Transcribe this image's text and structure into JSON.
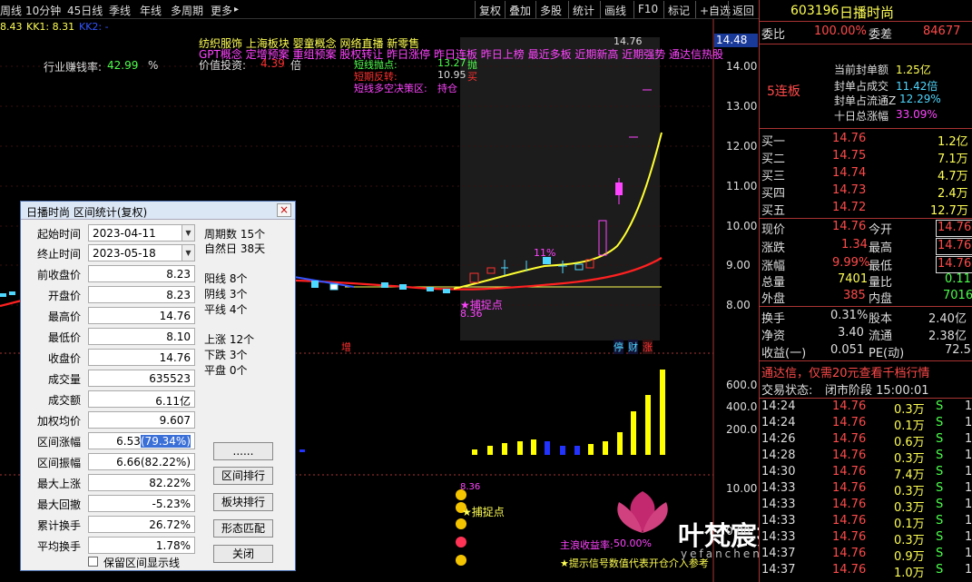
{
  "toolbar": {
    "left_tabs": [
      "周线",
      "10分钟",
      "45日线",
      "季线",
      "年线",
      "多周期",
      "更多"
    ],
    "more_arrow": "▸",
    "right_buttons": [
      "复权",
      "叠加",
      "多股",
      "统计",
      "画线",
      "F10",
      "标记",
      "+自选",
      "返回"
    ]
  },
  "indicator_line": {
    "a": "8.43",
    "kk1": "KK1: 8.31",
    "kk2": "KK2: -"
  },
  "chart_labels": {
    "industry_label": "行业赚钱率:",
    "industry_value": "42.99",
    "industry_unit": "%",
    "concepts": "纺织服饰  上海板块  婴童概念 网络直播 新零售",
    "tags": "GPT概念  定增预案 重组预案 股权转让 昨日涨停 昨日连板 昨日上榜 最近多板 近期新高 近期强势 通达信热股",
    "value_invest_label": "价值投资:",
    "value_invest_value": "4.39",
    "value_invest_unit": "倍",
    "short_point_label": "短线抛点:",
    "short_point_value": "13.27",
    "short_point_sig": "抛",
    "short_rev_label": "短期反转:",
    "short_rev_value": "10.95",
    "short_rev_sig": "买",
    "short_dec_label": "短线多空决策区:",
    "short_dec_value": "持仓",
    "top_price": "14.76",
    "pct_label": "11%",
    "capture_point": "★捕捉点",
    "capture_price": "8.36",
    "zeng": "增",
    "badges": [
      "停",
      "财",
      "涨"
    ],
    "sub_capture_price": "8.36",
    "sub_capture": "★捕捉点",
    "main_profit": "主浪收益率:",
    "main_profit_value": "50.00%",
    "hint": "★提示信号数值代表开仓介入参考",
    "watermark": "叶梵宸指标公式网",
    "watermark_url": "yefanchen.com"
  },
  "price_axis": {
    "current": "14.48",
    "ticks": [
      "14.00",
      "13.00",
      "12.00",
      "11.00",
      "10.00",
      "9.00",
      "8.00"
    ],
    "vol_ticks": [
      "600.0",
      "400.0",
      "200.0"
    ],
    "sub_ticks": [
      "10.00",
      "0.00"
    ]
  },
  "dialog": {
    "title": "日播时尚 区间统计(复权)",
    "close": "×",
    "start_label": "起始时间",
    "start_value": "2023-04-11",
    "end_label": "终止时间",
    "end_value": "2023-05-18",
    "period_label": "周期数 15个",
    "natural_label": "自然日 38天",
    "fields": [
      {
        "label": "前收盘价",
        "value": "8.23"
      },
      {
        "label": "开盘价",
        "value": "8.23"
      },
      {
        "label": "最高价",
        "value": "14.76"
      },
      {
        "label": "最低价",
        "value": "8.10"
      },
      {
        "label": "收盘价",
        "value": "14.76"
      },
      {
        "label": "成交量",
        "value": "635523"
      },
      {
        "label": "成交额",
        "value": "6.11亿"
      },
      {
        "label": "加权均价",
        "value": "9.607"
      },
      {
        "label": "区间涨幅",
        "value": "6.53",
        "value_hl": "(79.34%)"
      },
      {
        "label": "区间振幅",
        "value": "6.66(82.22%)"
      },
      {
        "label": "最大上涨",
        "value": "82.22%"
      },
      {
        "label": "最大回撤",
        "value": "-5.23%"
      },
      {
        "label": "累计换手",
        "value": "26.72%"
      },
      {
        "label": "平均换手",
        "value": "1.78%"
      }
    ],
    "right_stats": [
      "阳线 8个",
      "阴线 3个",
      "平线 4个",
      "上涨 12个",
      "下跌 3个",
      "平盘 0个"
    ],
    "buttons": [
      "......",
      "区间排行",
      "板块排行",
      "形态匹配",
      "关闭"
    ],
    "checkbox_label": "保留区间显示线"
  },
  "quote": {
    "code": "603196",
    "name": "日播时尚",
    "wb_label": "委比",
    "wb_value": "100.00%",
    "wc_label": "委差",
    "wc_value": "84677",
    "board": "5连板",
    "info": [
      {
        "label": "当前封单额",
        "value": "1.25亿"
      },
      {
        "label": "封单占成交",
        "value": "11.42倍"
      },
      {
        "label": "封单占流通Z",
        "value": "12.29%"
      },
      {
        "label": "十日总涨幅",
        "value": "33.09%"
      }
    ],
    "bids": [
      {
        "label": "买一",
        "price": "14.76",
        "vol": "1.2亿"
      },
      {
        "label": "买二",
        "price": "14.75",
        "vol": "7.1万"
      },
      {
        "label": "买三",
        "price": "14.74",
        "vol": "4.7万"
      },
      {
        "label": "买四",
        "price": "14.73",
        "vol": "2.4万"
      },
      {
        "label": "买五",
        "price": "14.72",
        "vol": "12.7万"
      }
    ],
    "stats": [
      {
        "l1": "现价",
        "v1": "14.76",
        "l2": "今开",
        "v2": "14.76"
      },
      {
        "l1": "涨跌",
        "v1": "1.34",
        "l2": "最高",
        "v2": "14.76"
      },
      {
        "l1": "涨幅",
        "v1": "9.99%",
        "l2": "最低",
        "v2": "14.76"
      },
      {
        "l1": "总量",
        "v1": "7401",
        "l2": "量比",
        "v2": "0.11"
      },
      {
        "l1": "外盘",
        "v1": "385",
        "l2": "内盘",
        "v2": "7016"
      }
    ],
    "stats2": [
      {
        "l1": "换手",
        "v1": "0.31%",
        "l2": "股本",
        "v2": "2.40亿"
      },
      {
        "l1": "净资",
        "v1": "3.40",
        "l2": "流通",
        "v2": "2.38亿"
      },
      {
        "l1": "收益(一)",
        "v1": "0.051",
        "l2": "PE(动)",
        "v2": "72.5"
      }
    ],
    "ad": "通达信，仅需20元查看千档行情",
    "status_label": "交易状态:",
    "status_value": "闭市阶段 15:00:01",
    "ticks": [
      {
        "t": "14:24",
        "p": "14.76",
        "v": "0.3万",
        "s": "S",
        "n": "1"
      },
      {
        "t": "14:24",
        "p": "14.76",
        "v": "0.1万",
        "s": "S",
        "n": "1"
      },
      {
        "t": "14:26",
        "p": "14.76",
        "v": "0.6万",
        "s": "S",
        "n": "1"
      },
      {
        "t": "14:28",
        "p": "14.76",
        "v": "0.3万",
        "s": "S",
        "n": "1"
      },
      {
        "t": "14:30",
        "p": "14.76",
        "v": "7.4万",
        "s": "S",
        "n": "1"
      },
      {
        "t": "14:33",
        "p": "14.76",
        "v": "0.3万",
        "s": "S",
        "n": "1"
      },
      {
        "t": "14:33",
        "p": "14.76",
        "v": "0.3万",
        "s": "S",
        "n": "1"
      },
      {
        "t": "14:33",
        "p": "14.76",
        "v": "0.1万",
        "s": "S",
        "n": "1"
      },
      {
        "t": "14:33",
        "p": "14.76",
        "v": "0.3万",
        "s": "S",
        "n": "1"
      },
      {
        "t": "14:37",
        "p": "14.76",
        "v": "0.9万",
        "s": "S",
        "n": "1"
      },
      {
        "t": "14:37",
        "p": "14.76",
        "v": "1.0万",
        "s": "S",
        "n": "1"
      }
    ]
  }
}
